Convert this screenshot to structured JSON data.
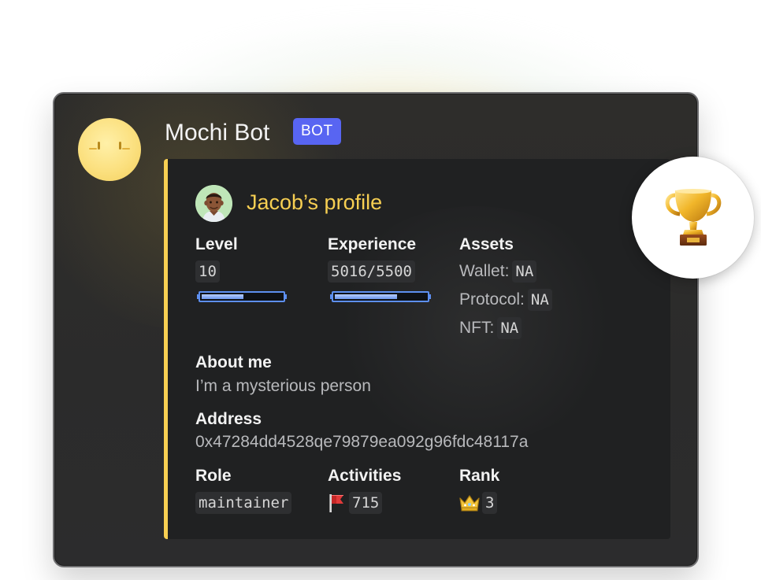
{
  "message": {
    "author": "Mochi Bot",
    "badge": "BOT"
  },
  "embed": {
    "title": "Jacob’s profile",
    "level": {
      "label": "Level",
      "value": "10",
      "progress": 0.52
    },
    "experience": {
      "label": "Experience",
      "value": "5016/5500",
      "progress": 0.68
    },
    "assets": {
      "label": "Assets",
      "items": [
        {
          "key": "Wallet:",
          "value": "NA"
        },
        {
          "key": "Protocol:",
          "value": "NA"
        },
        {
          "key": "NFT:",
          "value": "NA"
        }
      ]
    },
    "about": {
      "label": "About me",
      "value": "I’m a mysterious person"
    },
    "address": {
      "label": "Address",
      "value": "0x47284dd4528qe79879ea092g96fdc48117a"
    },
    "role": {
      "label": "Role",
      "value": "maintainer"
    },
    "activities": {
      "label": "Activities",
      "value": "715",
      "icon": "flag-icon"
    },
    "rank": {
      "label": "Rank",
      "value": "3",
      "icon": "crown-icon"
    }
  },
  "overlay": {
    "icon": "trophy-icon"
  },
  "colors": {
    "accent": "#f7cf52",
    "badge": "#5865f2",
    "progress": "#5d8ff0",
    "background": "#2b2b2b",
    "embed": "#202122"
  }
}
